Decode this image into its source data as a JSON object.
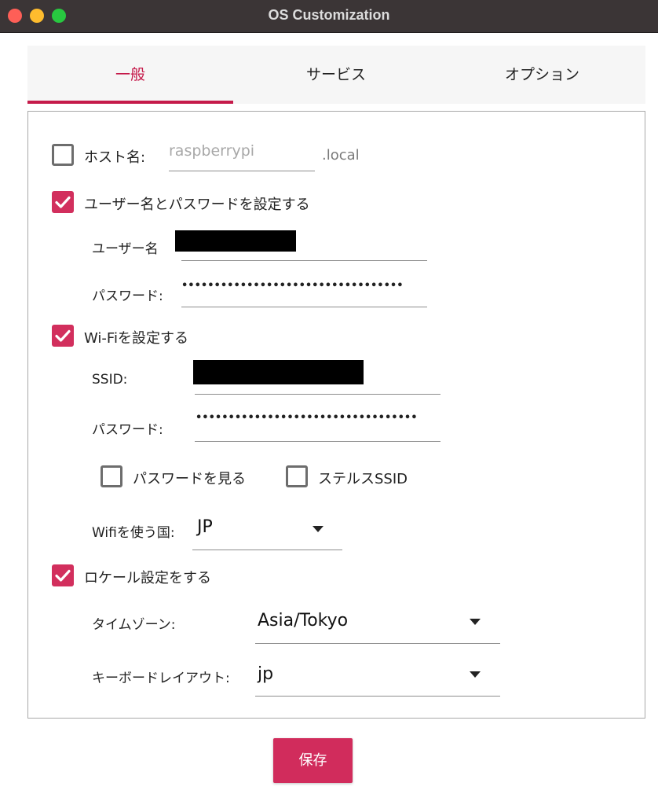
{
  "window": {
    "title": "OS Customization"
  },
  "tabs": [
    {
      "label": "一般",
      "active": true
    },
    {
      "label": "サービス",
      "active": false
    },
    {
      "label": "オプション",
      "active": false
    }
  ],
  "general": {
    "hostname": {
      "checked": false,
      "label": "ホスト名:",
      "placeholder": "raspberrypi",
      "suffix": ".local"
    },
    "user": {
      "checked": true,
      "label": "ユーザー名とパスワードを設定する",
      "username_label": "ユーザー名",
      "password_label": "パスワード:",
      "password_value": "••••••••••••••••••••••••••••••••••"
    },
    "wifi": {
      "checked": true,
      "label": "Wi-Fiを設定する",
      "ssid_label": "SSID:",
      "password_label": "パスワード:",
      "password_value": "••••••••••••••••••••••••••••••••••",
      "show_password": {
        "checked": false,
        "label": "パスワードを見る"
      },
      "hidden_ssid": {
        "checked": false,
        "label": "ステルスSSID"
      },
      "country_label": "Wifiを使う国:",
      "country_value": "JP"
    },
    "locale": {
      "checked": true,
      "label": "ロケール設定をする",
      "timezone_label": "タイムゾーン:",
      "timezone_value": "Asia/Tokyo",
      "keyboard_label": "キーボードレイアウト:",
      "keyboard_value": "jp"
    }
  },
  "buttons": {
    "save": "保存"
  },
  "colors": {
    "accent": "#c51a4a",
    "button": "#d12c5c",
    "titlebar": "#3b3536"
  }
}
